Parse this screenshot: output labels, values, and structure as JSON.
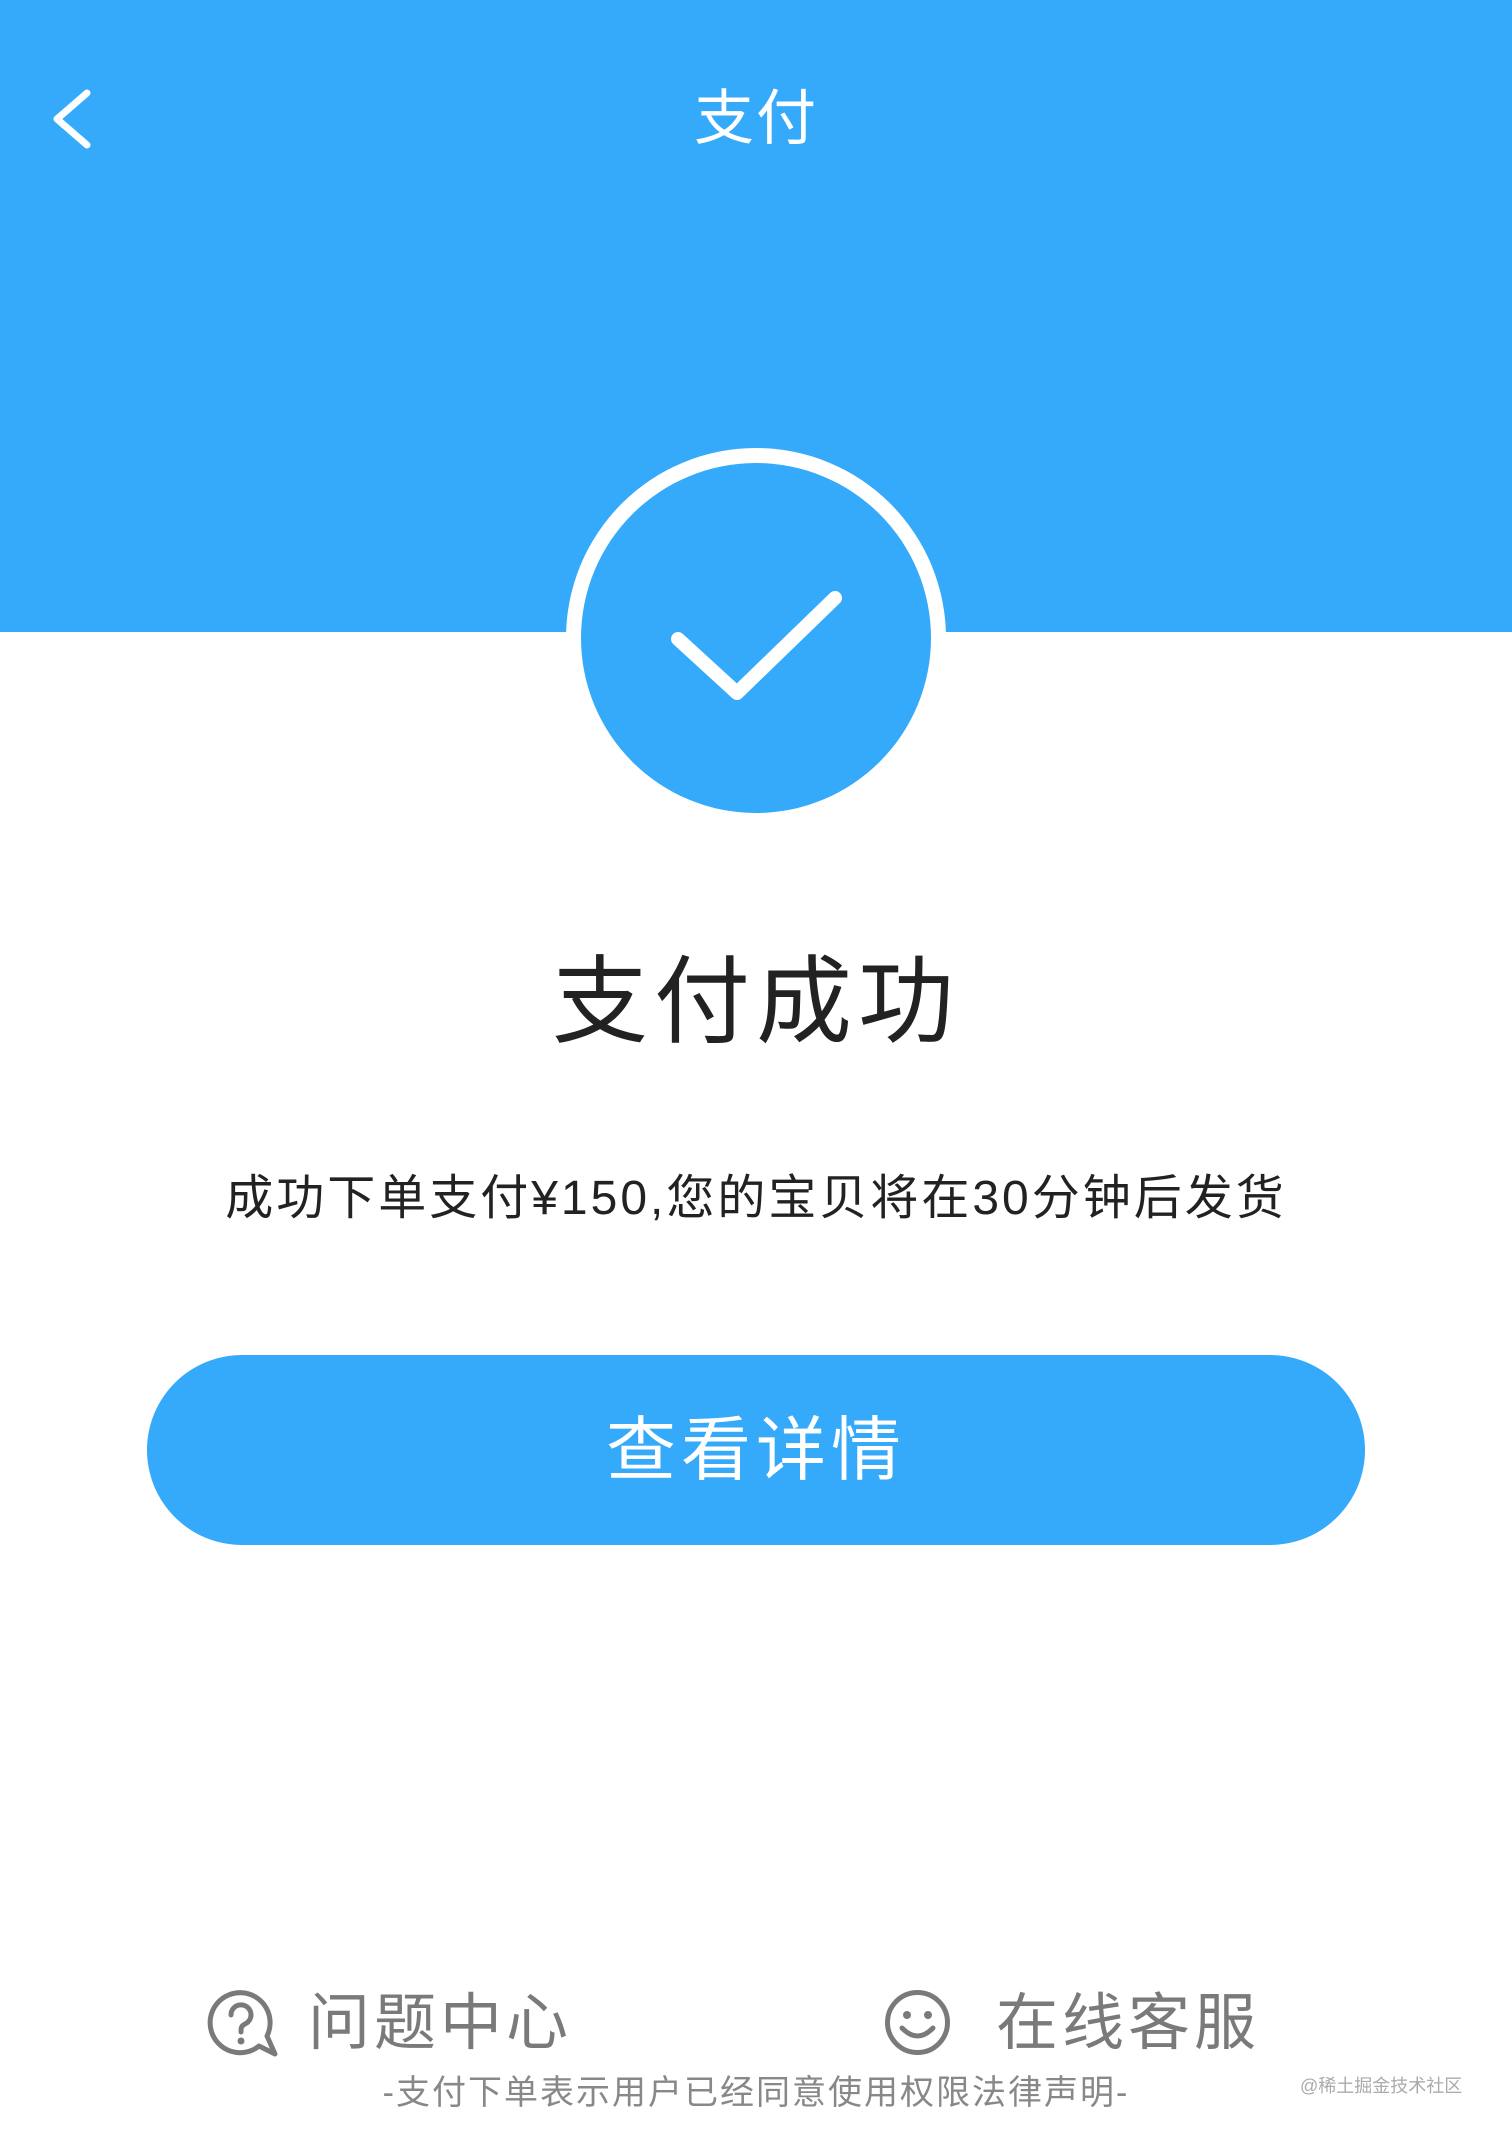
{
  "header": {
    "title": "支付",
    "back_icon": "chevron-left-icon"
  },
  "status": {
    "icon": "check-circle-icon",
    "title": "支付成功",
    "message": "成功下单支付¥150,您的宝贝将在30分钟后发货"
  },
  "actions": {
    "details_label": "查看详情"
  },
  "footer_links": [
    {
      "label": "问题中心",
      "icon": "question-bubble-icon"
    },
    {
      "label": "在线客服",
      "icon": "smiley-icon"
    }
  ],
  "legal_note": "-支付下单表示用户已经同意使用权限法律声明-",
  "watermark": "@稀土掘金技术社区",
  "colors": {
    "primary": "#35AAFB",
    "background": "#FFFFFF",
    "text": "#222222",
    "muted": "#7A7A7A"
  }
}
